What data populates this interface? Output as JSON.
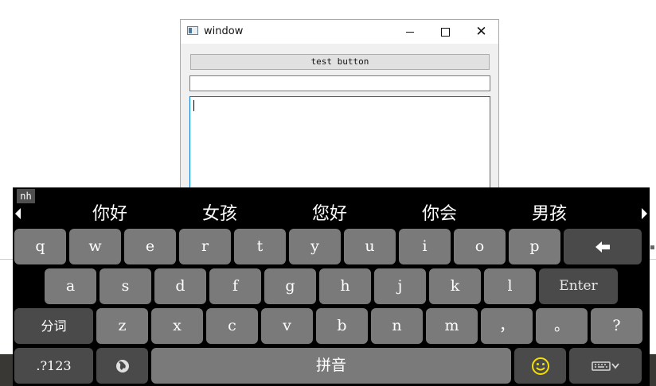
{
  "window": {
    "title": "window",
    "test_button_label": "test button",
    "line_edit_value": "",
    "text_area_value": ""
  },
  "keyboard": {
    "mode_label": "nh",
    "candidates": [
      "你好",
      "女孩",
      "您好",
      "你会",
      "男孩"
    ],
    "row1": [
      "q",
      "w",
      "e",
      "r",
      "t",
      "y",
      "u",
      "i",
      "o",
      "p"
    ],
    "row2": [
      "a",
      "s",
      "d",
      "f",
      "g",
      "h",
      "j",
      "k",
      "l"
    ],
    "enter_label": "Enter",
    "row3_mode_label": "分词",
    "row3": [
      "z",
      "x",
      "c",
      "v",
      "b",
      "n",
      "m",
      "，",
      "。",
      "?"
    ],
    "symbols_label": ".?123",
    "space_label": "拼音",
    "icons": {
      "backspace": "backspace-arrow-icon",
      "globe": "globe-icon",
      "emoji": "emoji-smiley-icon",
      "hide": "keyboard-hide-icon"
    }
  }
}
